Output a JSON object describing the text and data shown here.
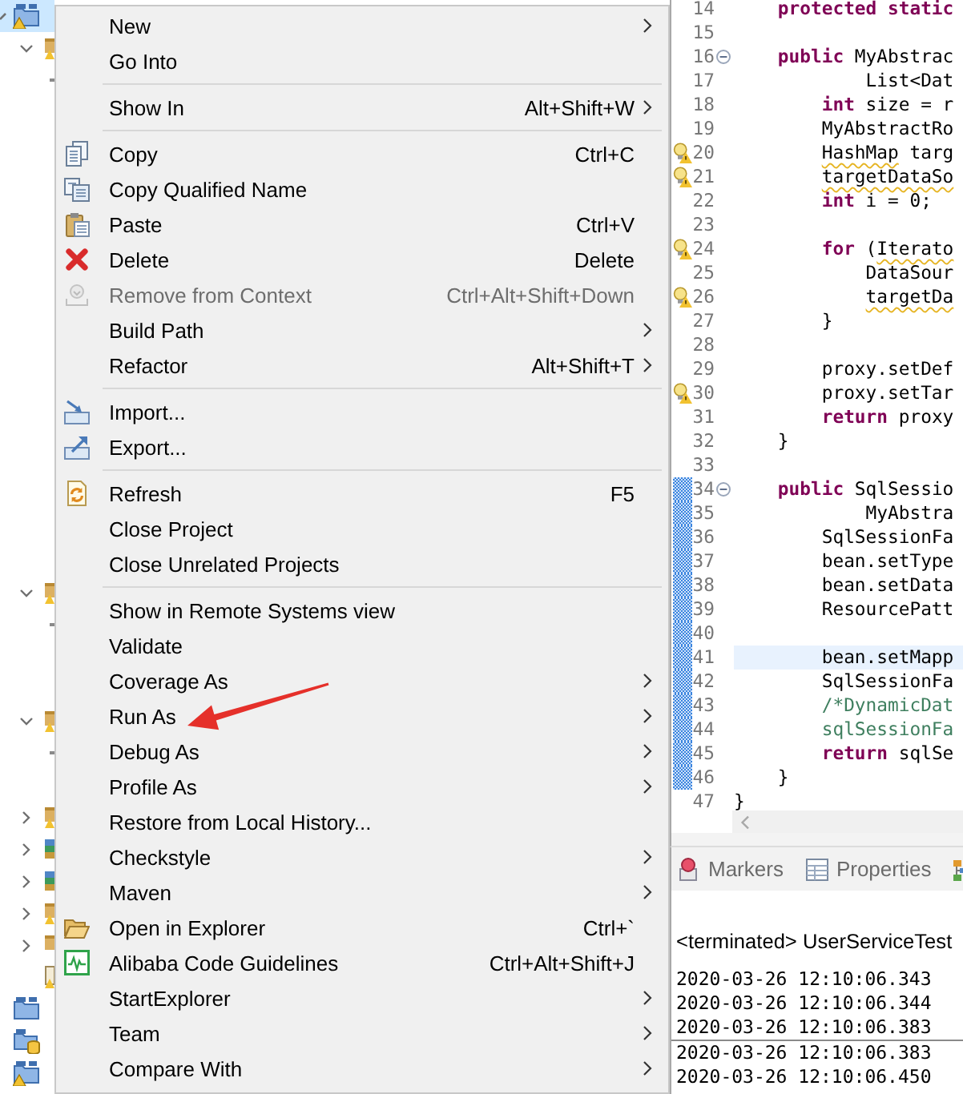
{
  "project_explorer": {
    "items": [
      {
        "kind": "project",
        "selected": true,
        "expanded": true,
        "warning": true,
        "children": [
          {
            "kind": "folder",
            "selected": false,
            "expanded": true,
            "warning": true,
            "children": [
              {
                "kind": "stub",
                "selected": false
              }
            ]
          },
          {
            "kind": "folder",
            "selected": false,
            "expanded": true,
            "warning": true,
            "children": [
              {
                "kind": "stub",
                "selected": false
              }
            ]
          },
          {
            "kind": "folder",
            "selected": false,
            "expanded": true,
            "warning": true,
            "children": [
              {
                "kind": "stub",
                "selected": false
              }
            ]
          },
          {
            "kind": "folder",
            "selected": false,
            "expanded": false,
            "warning": true
          },
          {
            "kind": "library",
            "selected": false,
            "expanded": false,
            "warning": false
          },
          {
            "kind": "library",
            "selected": false,
            "expanded": false,
            "warning": false
          },
          {
            "kind": "folder",
            "selected": false,
            "expanded": false,
            "warning": true
          },
          {
            "kind": "folder",
            "selected": false,
            "expanded": false,
            "warning": false
          },
          {
            "kind": "file",
            "selected": false,
            "warning": true
          }
        ]
      },
      {
        "kind": "project",
        "selected": false,
        "warning": false
      },
      {
        "kind": "project-db",
        "selected": false,
        "warning": false
      },
      {
        "kind": "project",
        "selected": false,
        "warning": true
      }
    ]
  },
  "menu": {
    "groups": [
      {
        "items": [
          {
            "label": "New",
            "kind": "plain",
            "submenu": true,
            "disabled": false,
            "marked": false
          },
          {
            "label": "Go Into",
            "kind": "plain",
            "submenu": false,
            "disabled": false,
            "marked": false
          }
        ]
      },
      {
        "items": [
          {
            "label": "Show In",
            "shortcut": "Alt+Shift+W",
            "kind": "plain",
            "submenu": true,
            "disabled": false,
            "marked": false
          }
        ]
      },
      {
        "items": [
          {
            "label": "Copy",
            "shortcut": "Ctrl+C",
            "kind": "copy",
            "submenu": false,
            "disabled": false,
            "marked": false
          },
          {
            "label": "Copy Qualified Name",
            "kind": "copy-name",
            "submenu": false,
            "disabled": false,
            "marked": false
          },
          {
            "label": "Paste",
            "shortcut": "Ctrl+V",
            "kind": "paste",
            "submenu": false,
            "disabled": false,
            "marked": false
          },
          {
            "label": "Delete",
            "shortcut": "Delete",
            "kind": "delete",
            "submenu": false,
            "disabled": false,
            "marked": false
          },
          {
            "label": "Remove from Context",
            "shortcut": "Ctrl+Alt+Shift+Down",
            "kind": "remove",
            "submenu": false,
            "disabled": true,
            "marked": false
          },
          {
            "label": "Build Path",
            "kind": "plain",
            "submenu": true,
            "disabled": false,
            "marked": false
          },
          {
            "label": "Refactor",
            "shortcut": "Alt+Shift+T",
            "kind": "plain",
            "submenu": true,
            "disabled": false,
            "marked": false
          }
        ]
      },
      {
        "items": [
          {
            "label": "Import...",
            "kind": "import",
            "submenu": false,
            "disabled": false,
            "marked": false
          },
          {
            "label": "Export...",
            "kind": "export",
            "submenu": false,
            "disabled": false,
            "marked": false
          }
        ]
      },
      {
        "items": [
          {
            "label": "Refresh",
            "shortcut": "F5",
            "kind": "refresh",
            "submenu": false,
            "disabled": false,
            "marked": false
          },
          {
            "label": "Close Project",
            "kind": "plain",
            "submenu": false,
            "disabled": false,
            "marked": false
          },
          {
            "label": "Close Unrelated Projects",
            "kind": "plain",
            "submenu": false,
            "disabled": false,
            "marked": false
          }
        ]
      },
      {
        "items": [
          {
            "label": "Show in Remote Systems view",
            "kind": "plain",
            "submenu": false,
            "disabled": false,
            "marked": false
          },
          {
            "label": "Validate",
            "kind": "plain",
            "submenu": false,
            "disabled": false,
            "marked": false
          },
          {
            "label": "Coverage As",
            "kind": "plain",
            "submenu": true,
            "disabled": false,
            "marked": false
          },
          {
            "label": "Run As",
            "kind": "plain",
            "submenu": true,
            "disabled": false,
            "marked": true
          },
          {
            "label": "Debug As",
            "kind": "plain",
            "submenu": true,
            "disabled": false,
            "marked": false
          },
          {
            "label": "Profile As",
            "kind": "plain",
            "submenu": true,
            "disabled": false,
            "marked": false
          },
          {
            "label": "Restore from Local History...",
            "kind": "plain",
            "submenu": false,
            "disabled": false,
            "marked": false
          },
          {
            "label": "Checkstyle",
            "kind": "plain",
            "submenu": true,
            "disabled": false,
            "marked": false
          },
          {
            "label": "Maven",
            "kind": "plain",
            "submenu": true,
            "disabled": false,
            "marked": false
          },
          {
            "label": "Open in Explorer",
            "shortcut": "Ctrl+`",
            "kind": "folder",
            "submenu": false,
            "disabled": false,
            "marked": false
          },
          {
            "label": "Alibaba Code Guidelines",
            "shortcut": "Ctrl+Alt+Shift+J",
            "kind": "guidelines",
            "submenu": false,
            "disabled": false,
            "marked": false
          },
          {
            "label": "StartExplorer",
            "kind": "plain",
            "submenu": true,
            "disabled": false,
            "marked": false
          },
          {
            "label": "Team",
            "kind": "plain",
            "submenu": true,
            "disabled": false,
            "marked": false
          },
          {
            "label": "Compare With",
            "kind": "plain",
            "submenu": true,
            "disabled": false,
            "marked": false
          }
        ]
      }
    ]
  },
  "editor": {
    "lines": [
      {
        "kind": "block",
        "children": [
          {
            "number": "14",
            "kind": "code",
            "tokens": [
              {
                "text": "protected static",
                "kind": "keyword"
              }
            ],
            "warning": false,
            "fold": false,
            "current": false,
            "changed": false
          },
          {
            "number": "15",
            "kind": "code",
            "warning": false,
            "fold": false,
            "current": false,
            "changed": false
          },
          {
            "number": "16",
            "kind": "code",
            "tokens": [
              {
                "text": "public",
                "kind": "keyword"
              },
              {
                "text": " MyAbstrac",
                "kind": "plain"
              }
            ],
            "warning": false,
            "fold": true,
            "current": false,
            "changed": false,
            "children": [
              {
                "number": "17",
                "kind": "continuation",
                "tokens": [
                  {
                    "text": "List<Dat",
                    "kind": "plain"
                  }
                ],
                "warning": false,
                "fold": false,
                "current": false,
                "changed": false
              },
              {
                "number": "18",
                "kind": "code",
                "tokens": [
                  {
                    "text": "int",
                    "kind": "keyword"
                  },
                  {
                    "text": " size = r",
                    "kind": "plain"
                  }
                ],
                "warning": false,
                "fold": false,
                "current": false,
                "changed": false
              },
              {
                "number": "19",
                "kind": "code",
                "tokens": [
                  {
                    "text": "MyAbstractRo",
                    "kind": "plain"
                  }
                ],
                "warning": false,
                "fold": false,
                "current": false,
                "changed": false
              },
              {
                "number": "20",
                "kind": "code",
                "tokens": [
                  {
                    "text": "HashMap",
                    "kind": "flagged"
                  },
                  {
                    "text": " targ",
                    "kind": "plain"
                  }
                ],
                "warning": true,
                "fold": false,
                "current": false,
                "changed": false
              },
              {
                "number": "21",
                "kind": "code",
                "tokens": [
                  {
                    "text": "targetDataSo",
                    "kind": "flagged"
                  }
                ],
                "warning": true,
                "fold": false,
                "current": false,
                "changed": false
              },
              {
                "number": "22",
                "kind": "code",
                "tokens": [
                  {
                    "text": "int",
                    "kind": "keyword"
                  },
                  {
                    "text": " i = 0;",
                    "kind": "plain"
                  }
                ],
                "warning": false,
                "fold": false,
                "current": false,
                "changed": false
              },
              {
                "number": "23",
                "kind": "code",
                "warning": false,
                "fold": false,
                "current": false,
                "changed": false
              },
              {
                "number": "24",
                "kind": "code",
                "tokens": [
                  {
                    "text": "for",
                    "kind": "keyword"
                  },
                  {
                    "text": " (",
                    "kind": "plain"
                  },
                  {
                    "text": "Iterato",
                    "kind": "flagged"
                  }
                ],
                "warning": true,
                "fold": false,
                "current": false,
                "changed": false,
                "children": [
                  {
                    "number": "25",
                    "kind": "code",
                    "tokens": [
                      {
                        "text": "DataSour",
                        "kind": "plain"
                      }
                    ],
                    "warning": false,
                    "fold": false,
                    "current": false,
                    "changed": false
                  },
                  {
                    "number": "26",
                    "kind": "code",
                    "tokens": [
                      {
                        "text": "targetDa",
                        "kind": "flagged"
                      }
                    ],
                    "warning": true,
                    "fold": false,
                    "current": false,
                    "changed": false
                  }
                ]
              },
              {
                "number": "27",
                "kind": "code",
                "tokens": [
                  {
                    "text": "}",
                    "kind": "plain"
                  }
                ],
                "warning": false,
                "fold": false,
                "current": false,
                "changed": false
              },
              {
                "number": "28",
                "kind": "code",
                "warning": false,
                "fold": false,
                "current": false,
                "changed": false
              },
              {
                "number": "29",
                "kind": "code",
                "tokens": [
                  {
                    "text": "proxy.setDef",
                    "kind": "plain"
                  }
                ],
                "warning": false,
                "fold": false,
                "current": false,
                "changed": false
              },
              {
                "number": "30",
                "kind": "code",
                "tokens": [
                  {
                    "text": "proxy.setTar",
                    "kind": "plain"
                  }
                ],
                "warning": true,
                "fold": false,
                "current": false,
                "changed": false
              },
              {
                "number": "31",
                "kind": "code",
                "tokens": [
                  {
                    "text": "return",
                    "kind": "keyword"
                  },
                  {
                    "text": " proxy",
                    "kind": "plain"
                  }
                ],
                "warning": false,
                "fold": false,
                "current": false,
                "changed": false
              }
            ]
          },
          {
            "number": "32",
            "kind": "code",
            "tokens": [
              {
                "text": "}",
                "kind": "plain"
              }
            ],
            "warning": false,
            "fold": false,
            "current": false,
            "changed": false
          },
          {
            "number": "33",
            "kind": "code",
            "warning": false,
            "fold": false,
            "current": false,
            "changed": false
          },
          {
            "number": "34",
            "kind": "code",
            "tokens": [
              {
                "text": "public",
                "kind": "keyword"
              },
              {
                "text": " SqlSessio",
                "kind": "plain"
              }
            ],
            "warning": false,
            "fold": true,
            "current": false,
            "changed": true,
            "children": [
              {
                "number": "35",
                "kind": "continuation",
                "tokens": [
                  {
                    "text": "MyAbstra",
                    "kind": "plain"
                  }
                ],
                "warning": false,
                "fold": false,
                "current": false,
                "changed": true
              },
              {
                "number": "36",
                "kind": "code",
                "tokens": [
                  {
                    "text": "SqlSessionFa",
                    "kind": "plain"
                  }
                ],
                "warning": false,
                "fold": false,
                "current": false,
                "changed": true
              },
              {
                "number": "37",
                "kind": "code",
                "tokens": [
                  {
                    "text": "bean.setType",
                    "kind": "plain"
                  }
                ],
                "warning": false,
                "fold": false,
                "current": false,
                "changed": true
              },
              {
                "number": "38",
                "kind": "code",
                "tokens": [
                  {
                    "text": "bean.setData",
                    "kind": "plain"
                  }
                ],
                "warning": false,
                "fold": false,
                "current": false,
                "changed": true
              },
              {
                "number": "39",
                "kind": "code",
                "tokens": [
                  {
                    "text": "ResourcePatt",
                    "kind": "plain"
                  }
                ],
                "warning": false,
                "fold": false,
                "current": false,
                "changed": true
              },
              {
                "number": "40",
                "kind": "code",
                "warning": false,
                "fold": false,
                "current": false,
                "changed": true
              },
              {
                "number": "41",
                "kind": "code",
                "tokens": [
                  {
                    "text": "bean.setMapp",
                    "kind": "plain"
                  }
                ],
                "warning": false,
                "fold": false,
                "current": true,
                "changed": true
              },
              {
                "number": "42",
                "kind": "code",
                "tokens": [
                  {
                    "text": "SqlSessionFa",
                    "kind": "plain"
                  }
                ],
                "warning": false,
                "fold": false,
                "current": false,
                "changed": true
              },
              {
                "number": "43",
                "kind": "code",
                "tokens": [
                  {
                    "text": "/*DynamicDat",
                    "kind": "comment"
                  }
                ],
                "warning": false,
                "fold": false,
                "current": false,
                "changed": true
              },
              {
                "number": "44",
                "kind": "code",
                "tokens": [
                  {
                    "text": "sqlSessionFa",
                    "kind": "comment"
                  }
                ],
                "warning": false,
                "fold": false,
                "current": false,
                "changed": true
              },
              {
                "number": "45",
                "kind": "code",
                "tokens": [
                  {
                    "text": "return",
                    "kind": "keyword"
                  },
                  {
                    "text": " sqlSe",
                    "kind": "plain"
                  }
                ],
                "warning": false,
                "fold": false,
                "current": false,
                "changed": true
              }
            ]
          },
          {
            "number": "46",
            "kind": "code",
            "tokens": [
              {
                "text": "}",
                "kind": "plain"
              }
            ],
            "warning": false,
            "fold": false,
            "current": false,
            "changed": true
          }
        ]
      },
      {
        "number": "47",
        "kind": "code",
        "tokens": [
          {
            "text": "}",
            "kind": "plain"
          }
        ],
        "warning": false,
        "fold": false,
        "current": false,
        "changed": false
      }
    ]
  },
  "panel_tabs": [
    {
      "label": "Markers",
      "kind": "markers",
      "selected": false
    },
    {
      "label": "Properties",
      "kind": "properties",
      "selected": false
    },
    {
      "kind": "other",
      "selected": false
    }
  ],
  "console": {
    "title": "<terminated> UserServiceTest",
    "lines": [
      "2020-03-26 12:10:06.343",
      "2020-03-26 12:10:06.344",
      "2020-03-26 12:10:06.383",
      "2020-03-26 12:10:06.383",
      "2020-03-26 12:10:06.450"
    ]
  }
}
